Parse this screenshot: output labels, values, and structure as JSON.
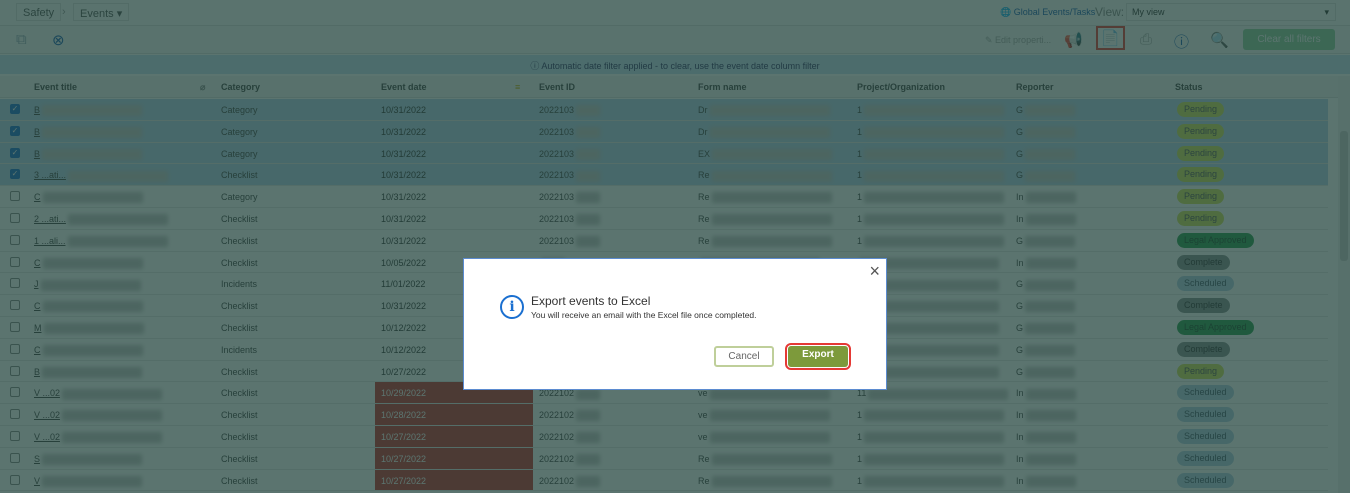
{
  "breadcrumb": {
    "root": "Safety",
    "current": "Events"
  },
  "topright": {
    "global_link": "Global Events/Tasks",
    "view_label": "View:",
    "view_value": "My view"
  },
  "toolbar": {
    "edit_properties": "Edit properti...",
    "clear_filters": "Clear all filters"
  },
  "notice": "Automatic date filter applied - to clear, use the event date column filter",
  "columns": [
    "Event title",
    "Category",
    "Event date",
    "Event ID",
    "Form name",
    "Project/Organization",
    "Reporter",
    "Status"
  ],
  "status_colors": {
    "Pending": "#d4e157",
    "Legal Approved": "#2e9e4f",
    "Complete": "#8a8f8f",
    "Scheduled": "#b3d1e6"
  },
  "rows": [
    {
      "title": "B",
      "category": "Category",
      "date": "10/31/2022",
      "id": "2022103",
      "form": "Dr",
      "project": "1",
      "reporter": "G",
      "status": "Pending",
      "selected": true,
      "overdue": false
    },
    {
      "title": "B",
      "category": "Category",
      "date": "10/31/2022",
      "id": "2022103",
      "form": "Dr",
      "project": "1",
      "reporter": "G",
      "status": "Pending",
      "selected": true,
      "overdue": false
    },
    {
      "title": "B",
      "category": "Category",
      "date": "10/31/2022",
      "id": "2022103",
      "form": "EX",
      "project": "1",
      "reporter": "G",
      "status": "Pending",
      "selected": true,
      "overdue": false
    },
    {
      "title": "3 ...ati...",
      "category": "Checklist",
      "date": "10/31/2022",
      "id": "2022103",
      "form": "Re",
      "project": "1",
      "reporter": "G",
      "status": "Pending",
      "selected": true,
      "overdue": false
    },
    {
      "title": "C",
      "category": "Category",
      "date": "10/31/2022",
      "id": "2022103",
      "form": "Re",
      "project": "1",
      "reporter": "In",
      "status": "Pending",
      "selected": false,
      "overdue": false
    },
    {
      "title": "2 ...ati...",
      "category": "Checklist",
      "date": "10/31/2022",
      "id": "2022103",
      "form": "Re",
      "project": "1",
      "reporter": "In",
      "status": "Pending",
      "selected": false,
      "overdue": false
    },
    {
      "title": "1 ...ali...",
      "category": "Checklist",
      "date": "10/31/2022",
      "id": "2022103",
      "form": "Re",
      "project": "1",
      "reporter": "G",
      "status": "Legal Approved",
      "selected": false,
      "overdue": false
    },
    {
      "title": "C",
      "category": "Checklist",
      "date": "10/05/2022",
      "id": "",
      "form": "",
      "project": "",
      "reporter": "In",
      "status": "Complete",
      "selected": false,
      "overdue": false
    },
    {
      "title": "J",
      "category": "Incidents",
      "date": "11/01/2022",
      "id": "",
      "form": "",
      "project": "",
      "reporter": "G",
      "status": "Scheduled",
      "selected": false,
      "overdue": false
    },
    {
      "title": "C",
      "category": "Checklist",
      "date": "10/31/2022",
      "id": "",
      "form": "",
      "project": "",
      "reporter": "G",
      "status": "Complete",
      "selected": false,
      "overdue": false
    },
    {
      "title": "M",
      "category": "Checklist",
      "date": "10/12/2022",
      "id": "",
      "form": "",
      "project": "",
      "reporter": "G",
      "status": "Legal Approved",
      "selected": false,
      "overdue": false
    },
    {
      "title": "C",
      "category": "Incidents",
      "date": "10/12/2022",
      "id": "",
      "form": "",
      "project": "",
      "reporter": "G",
      "status": "Complete",
      "selected": false,
      "overdue": false
    },
    {
      "title": "B",
      "category": "Checklist",
      "date": "10/27/2022",
      "id": "",
      "form": "",
      "project": "",
      "reporter": "G",
      "status": "Pending",
      "selected": false,
      "overdue": false
    },
    {
      "title": "V ...02",
      "category": "Checklist",
      "date": "10/29/2022",
      "id": "2022102",
      "form": "ve",
      "project": "11",
      "reporter": "In",
      "status": "Scheduled",
      "selected": false,
      "overdue": true
    },
    {
      "title": "V ...02",
      "category": "Checklist",
      "date": "10/28/2022",
      "id": "2022102",
      "form": "ve",
      "project": "1",
      "reporter": "In",
      "status": "Scheduled",
      "selected": false,
      "overdue": true
    },
    {
      "title": "V ...02",
      "category": "Checklist",
      "date": "10/27/2022",
      "id": "2022102",
      "form": "ve",
      "project": "1",
      "reporter": "In",
      "status": "Scheduled",
      "selected": false,
      "overdue": true
    },
    {
      "title": "S",
      "category": "Checklist",
      "date": "10/27/2022",
      "id": "2022102",
      "form": "Re",
      "project": "1",
      "reporter": "In",
      "status": "Scheduled",
      "selected": false,
      "overdue": true
    },
    {
      "title": "V",
      "category": "Checklist",
      "date": "10/27/2022",
      "id": "2022102",
      "form": "Re",
      "project": "1",
      "reporter": "In",
      "status": "Scheduled",
      "selected": false,
      "overdue": true
    }
  ],
  "dialog": {
    "title": "Export events to Excel",
    "message": "You will receive an email with the Excel file once completed.",
    "cancel": "Cancel",
    "export": "Export"
  }
}
